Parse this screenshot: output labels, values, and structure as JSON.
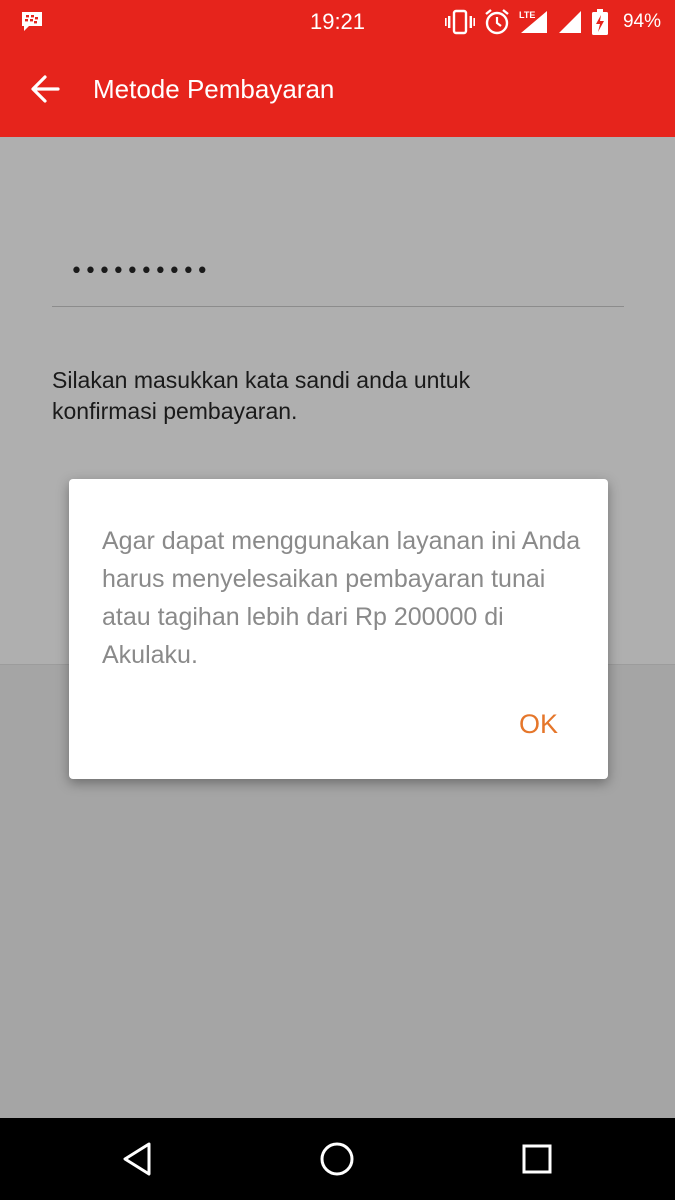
{
  "status_bar": {
    "time": "19:21",
    "battery": "94%",
    "network": "LTE",
    "icons": [
      "bbm-icon",
      "vibrate-icon",
      "alarm-icon",
      "lte-signal-icon",
      "signal-icon",
      "battery-charging-icon"
    ]
  },
  "app_bar": {
    "title": "Metode Pembayaran",
    "back_icon": "arrow-left-icon"
  },
  "form": {
    "password_value": "••••••••••",
    "instruction": "Silakan masukkan kata sandi anda untuk konfirmasi pembayaran."
  },
  "dialog": {
    "message": "Agar dapat menggunakan layanan ini Anda harus menyelesaikan pembayaran tunai atau tagihan lebih dari Rp 200000 di Akulaku.",
    "ok_label": "OK"
  },
  "nav_bar": {
    "items": [
      "back-triangle-icon",
      "home-circle-icon",
      "recents-square-icon"
    ]
  },
  "colors": {
    "primary": "#e6241c",
    "accent": "#e5762a",
    "scrim": "#afafaf"
  }
}
